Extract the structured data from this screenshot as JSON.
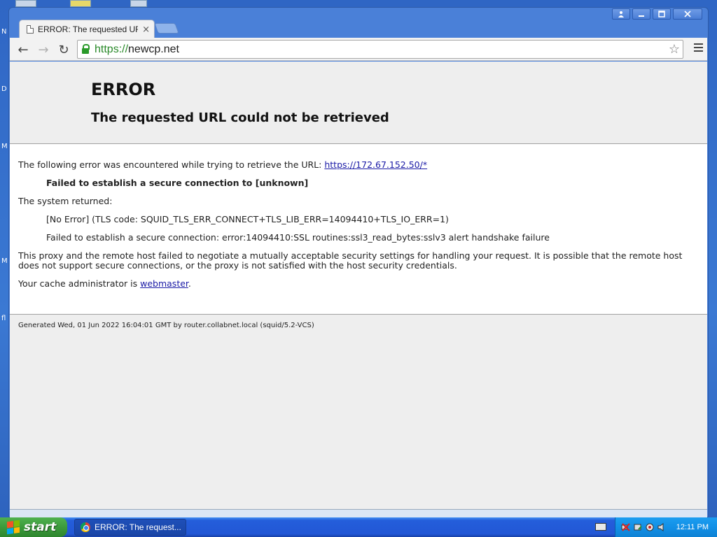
{
  "desktop": {
    "side_letters": [
      "N",
      "D",
      "M",
      "M",
      "fl"
    ]
  },
  "window": {
    "controls": {
      "user_icon": "user-icon",
      "minimize_icon": "minimize-icon",
      "maximize_icon": "maximize-icon",
      "close_icon": "close-icon"
    }
  },
  "tab": {
    "title": "ERROR: The requested URL",
    "close_glyph": "×"
  },
  "toolbar": {
    "back_glyph": "←",
    "forward_glyph": "→",
    "reload_glyph": "↻",
    "url_scheme": "https://",
    "url_host": "newcp.net",
    "star_glyph": "☆"
  },
  "page": {
    "title": "ERROR",
    "subtitle": "The requested URL could not be retrieved",
    "intro": "The following error was encountered while trying to retrieve the URL:",
    "error_url": "https://172.67.152.50/*",
    "failure": "Failed to establish a secure connection to [unknown]",
    "system_returned": "The system returned:",
    "tls_code": "[No Error] (TLS code: SQUID_TLS_ERR_CONNECT+TLS_LIB_ERR=14094410+TLS_IO_ERR=1)",
    "ssl_error": "Failed to establish a secure connection: error:14094410:SSL routines:ssl3_read_bytes:sslv3 alert handshake failure",
    "explanation": "This proxy and the remote host failed to negotiate a mutually acceptable security settings for handling your request. It is possible that the remote host does not support secure connections, or the proxy is not satisfied with the host security credentials.",
    "admin_prefix": "Your cache administrator is ",
    "admin_link": "webmaster",
    "admin_suffix": ".",
    "footer": "Generated Wed, 01 Jun 2022 16:04:01 GMT by router.collabnet.local (squid/5.2-VCS)"
  },
  "taskbar": {
    "start_label": "start",
    "task_label": "ERROR: The request...",
    "clock": "12:11 PM"
  }
}
